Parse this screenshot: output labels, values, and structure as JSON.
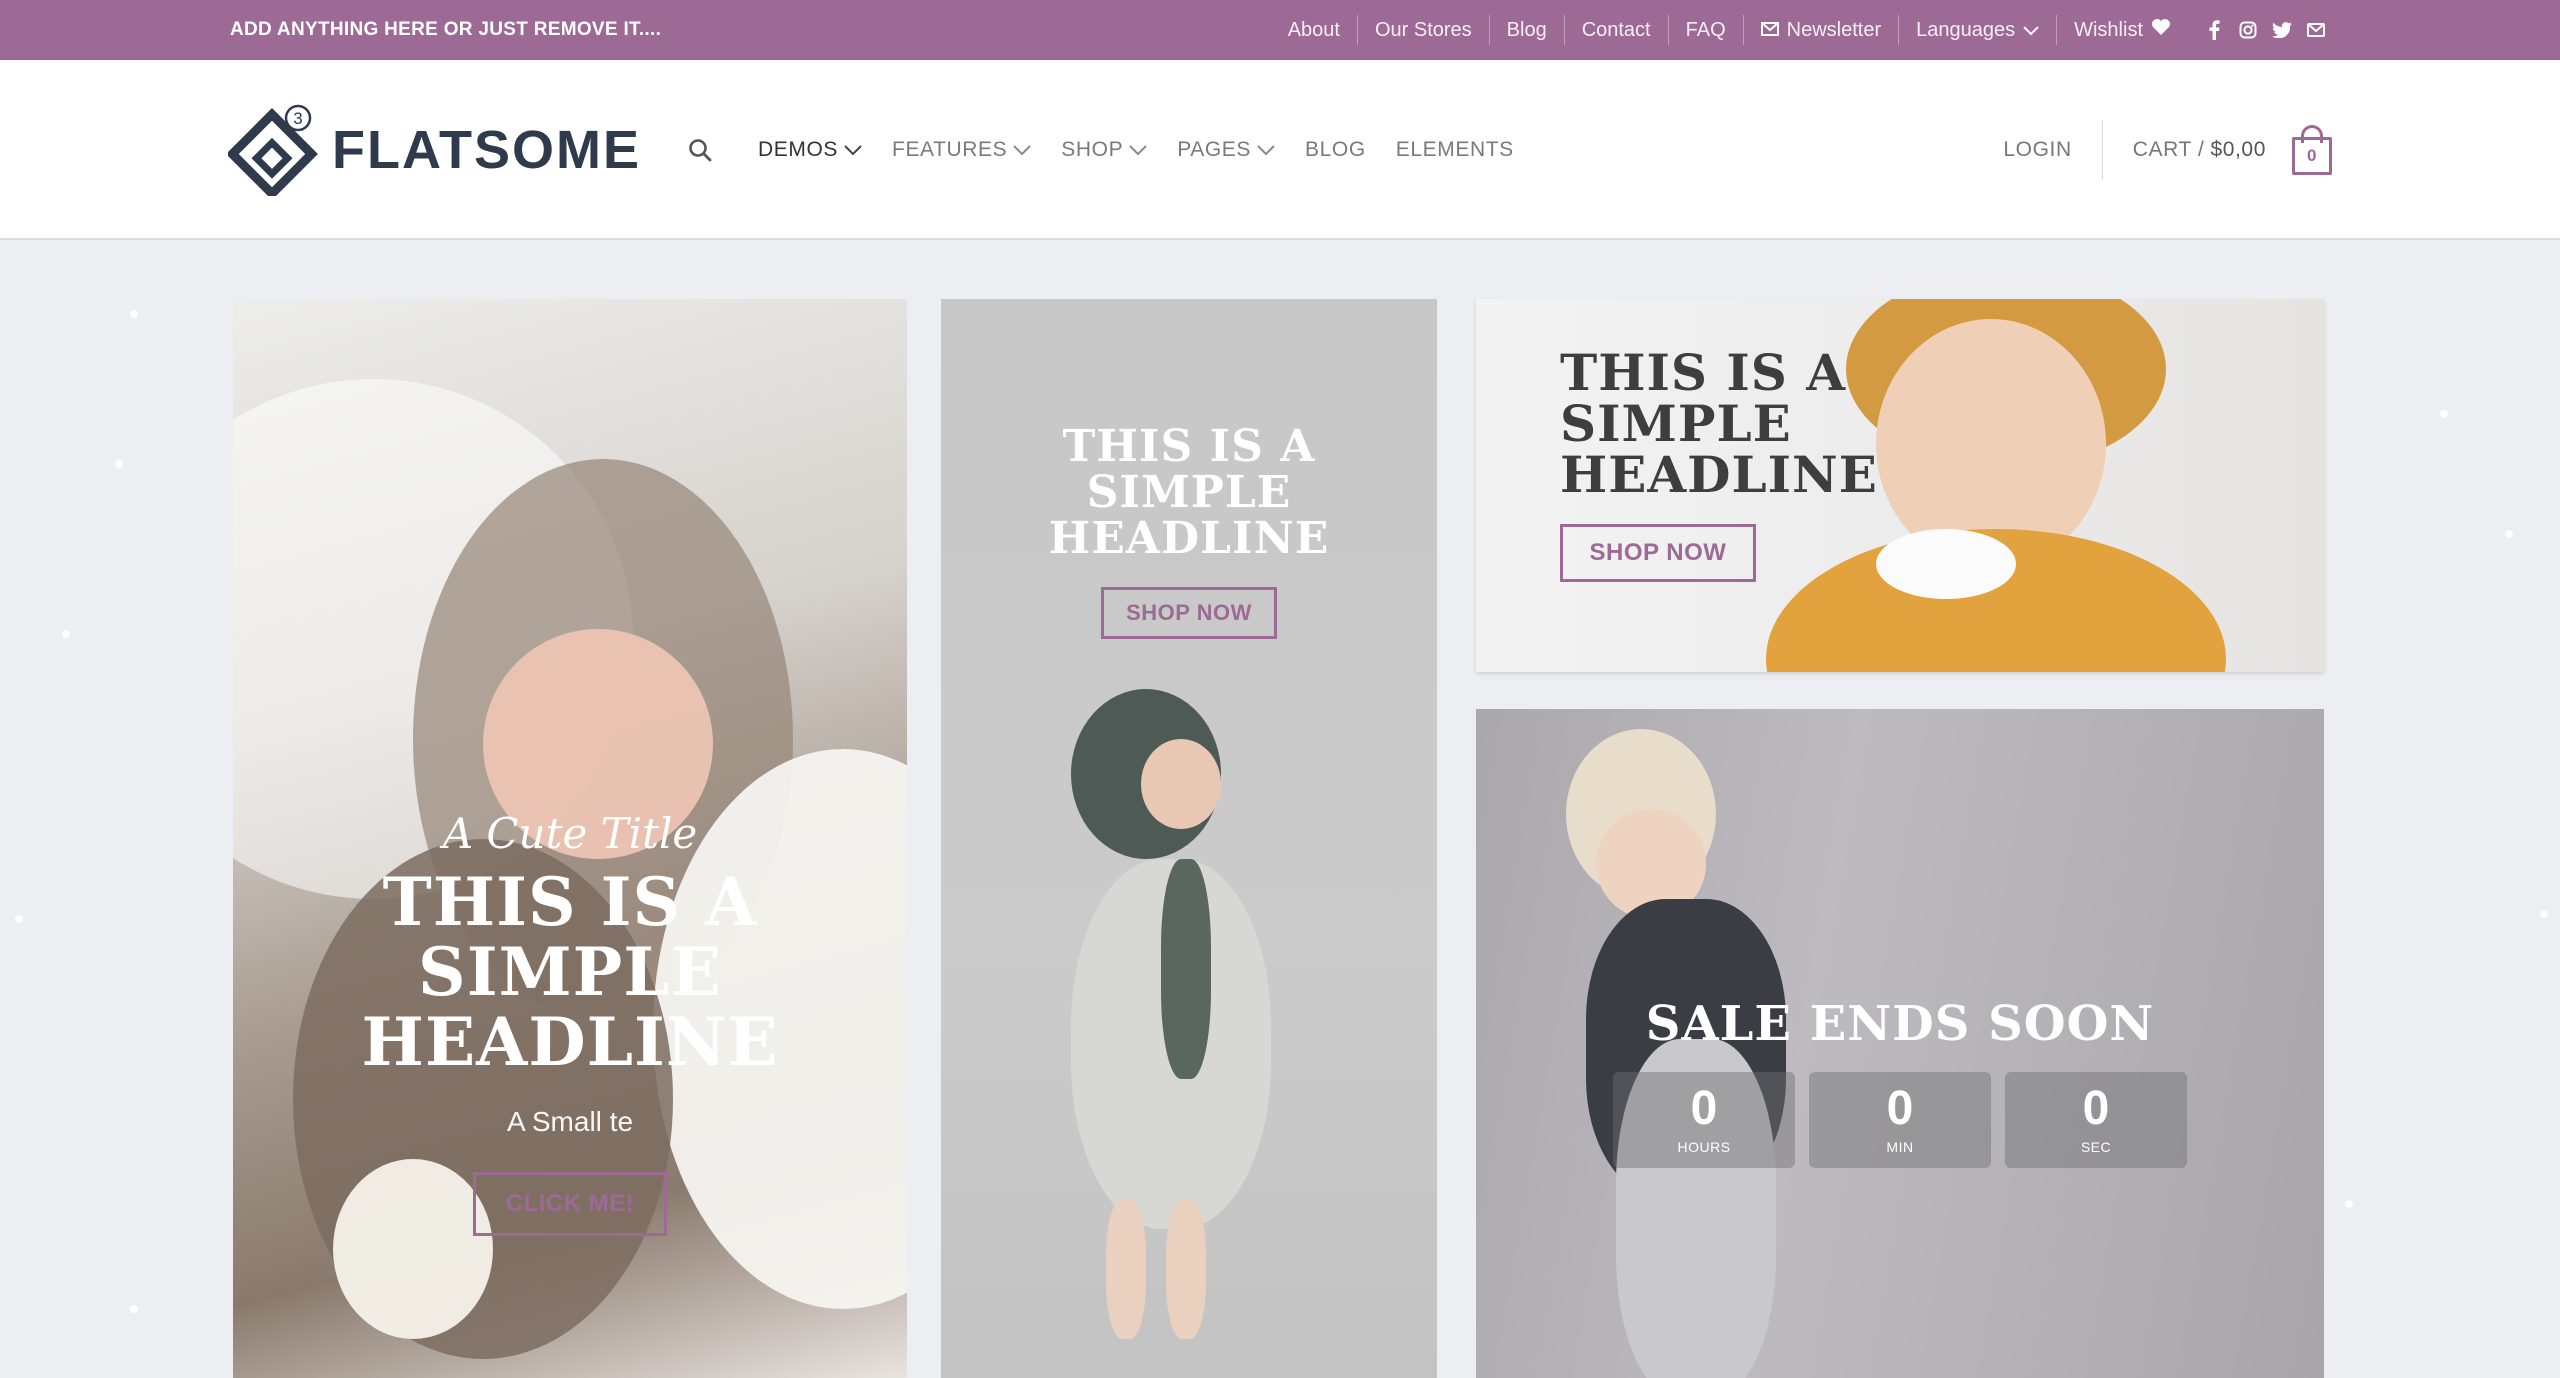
{
  "colors": {
    "accent": "#9d6a96",
    "topbar_bg": "#9d6a96",
    "page_bg": "#eceef1",
    "brand_text": "#2f3b4c"
  },
  "topbar": {
    "promo": "ADD ANYTHING HERE OR JUST REMOVE IT....",
    "links": {
      "about": "About",
      "stores": "Our Stores",
      "blog": "Blog",
      "contact": "Contact",
      "faq": "FAQ",
      "newsletter": "Newsletter",
      "languages": "Languages",
      "wishlist": "Wishlist"
    },
    "social_icons": [
      "facebook-icon",
      "instagram-icon",
      "twitter-icon",
      "mail-icon"
    ]
  },
  "header": {
    "brand": "FLATSOME",
    "logo_badge": "3",
    "nav": {
      "demos": "DEMOS",
      "features": "FEATURES",
      "shop": "SHOP",
      "pages": "PAGES",
      "blog": "BLOG",
      "elements": "ELEMENTS"
    },
    "login": "LOGIN",
    "cart_label": "CART /",
    "cart_amount": "$0,00",
    "cart_count": "0"
  },
  "tiles": {
    "tile1": {
      "script_title": "A Cute Title",
      "headline_1": "THIS IS A",
      "headline_2": "SIMPLE",
      "headline_3": "HEADLINE",
      "small_text": "A Small te",
      "button": "CLICK ME!"
    },
    "tile2": {
      "headline_1": "THIS IS A",
      "headline_2": "SIMPLE",
      "headline_3": "HEADLINE",
      "button": "SHOP NOW"
    },
    "tile3": {
      "headline_1": "THIS IS A",
      "headline_2": "SIMPLE",
      "headline_3": "HEADLINE",
      "button": "SHOP NOW"
    },
    "tile4": {
      "headline": "SALE ENDS SOON",
      "countdown": [
        {
          "value": "0",
          "label": "HOURS"
        },
        {
          "value": "0",
          "label": "MIN"
        },
        {
          "value": "0",
          "label": "SEC"
        }
      ]
    }
  }
}
